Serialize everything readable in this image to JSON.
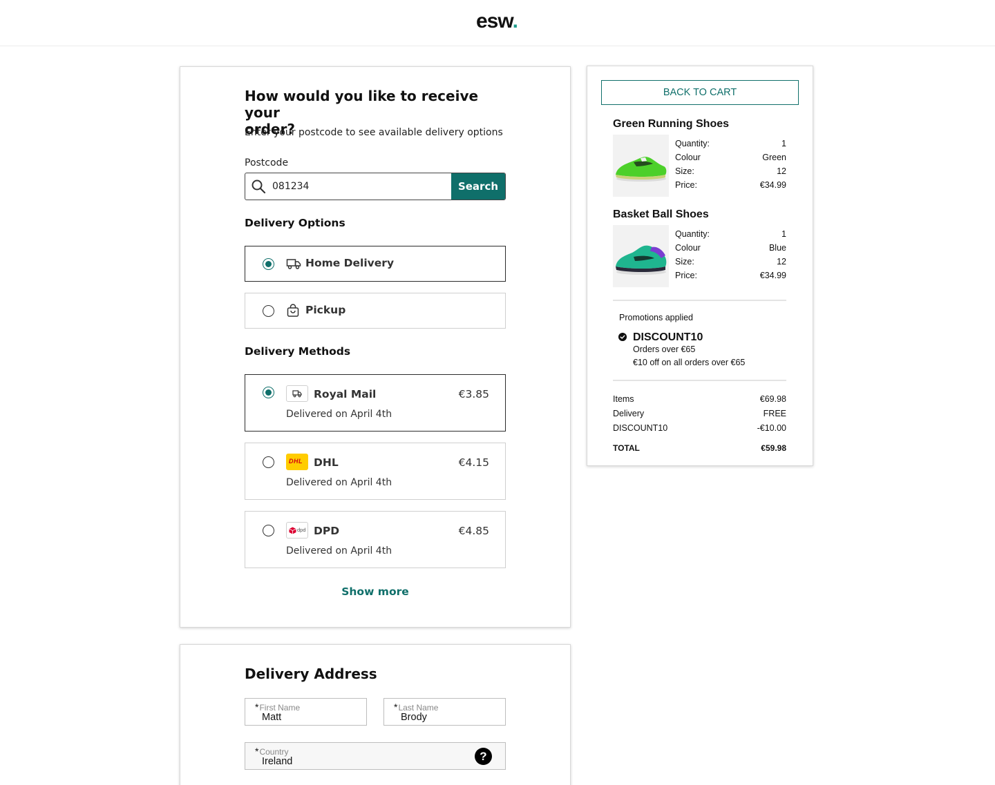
{
  "header": {
    "logo_text": "esw",
    "logo_dot": "."
  },
  "delivery": {
    "heading_line1": "How would you like to receive your",
    "heading_line2": "order?",
    "subheading": "Enter your postcode to see available delivery options",
    "postcode_label": "Postcode",
    "postcode_value": "081234",
    "search_button": "Search",
    "options_title": "Delivery Options",
    "options": [
      {
        "label": "Home Delivery",
        "selected": true,
        "icon": "truck-icon"
      },
      {
        "label": "Pickup",
        "selected": false,
        "icon": "shopping-bag-icon"
      }
    ],
    "methods_title": "Delivery Methods",
    "methods": [
      {
        "name": "Royal Mail",
        "price": "€3.85",
        "eta": "Delivered on April 4th",
        "selected": true,
        "logo": "truck-icon"
      },
      {
        "name": "DHL",
        "price": "€4.15",
        "eta": "Delivered on April 4th",
        "selected": false,
        "logo": "dhl-logo"
      },
      {
        "name": "DPD",
        "price": "€4.85",
        "eta": "Delivered on April 4th",
        "selected": false,
        "logo": "dpd-logo"
      }
    ],
    "dhl_logo_text": "DHL",
    "dpd_logo_text": "dpd",
    "show_more": "Show more"
  },
  "address": {
    "title": "Delivery Address",
    "first_name_label": "First Name",
    "first_name_value": "Matt",
    "last_name_label": "Last Name",
    "last_name_value": "Brody",
    "country_label": "Country",
    "country_value": "Ireland",
    "required_mark": "*",
    "help_glyph": "?"
  },
  "summary": {
    "back_button": "BACK TO CART",
    "products": [
      {
        "name": "Green Running Shoes",
        "quantity_label": "Quantity:",
        "quantity": "1",
        "colour_label": "Colour",
        "colour": "Green",
        "size_label": "Size:",
        "size": "12",
        "price_label": "Price:",
        "price": "€34.99"
      },
      {
        "name": "Basket Ball Shoes",
        "quantity_label": "Quantity:",
        "quantity": "1",
        "colour_label": "Colour",
        "colour": "Blue",
        "size_label": "Size:",
        "size": "12",
        "price_label": "Price:",
        "price": "€34.99"
      }
    ],
    "promotions_title": "Promotions applied",
    "promo_code": "DISCOUNT10",
    "promo_condition": "Orders over €65",
    "promo_description": "€10 off on all orders over €65",
    "totals": [
      {
        "label": "Items",
        "value": "€69.98"
      },
      {
        "label": "Delivery",
        "value": "FREE"
      },
      {
        "label": "DISCOUNT10",
        "value": "-€10.00"
      }
    ],
    "total_label": "TOTAL",
    "total_value": "€59.98"
  },
  "colors": {
    "accent": "#0f6f6a",
    "logo_dot": "#1f9c8c",
    "dhl_yellow": "#ffcc00",
    "dhl_red": "#d40511",
    "dpd_red": "#dc0032"
  }
}
